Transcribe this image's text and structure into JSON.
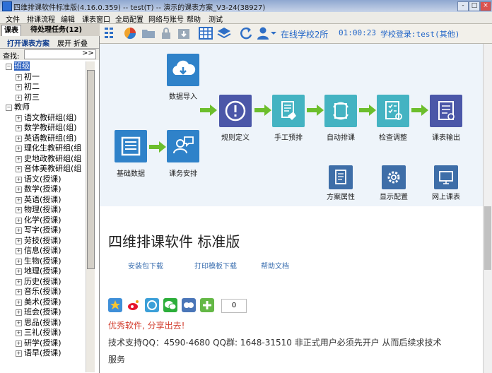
{
  "window": {
    "title": "四维排课软件标准版(4.16.0.359) -- test(T) -- 演示的课表方案_V3-24(38927)",
    "minimize": "-",
    "maximize": "□",
    "close": "×"
  },
  "menu": [
    "文件",
    "排课流程",
    "编辑",
    "课表窗口",
    "全局配置",
    "网络与账号",
    "帮助",
    "测试"
  ],
  "left_tabs": [
    "课表",
    "待处理任务(12)"
  ],
  "left_actions": {
    "open": "打开课表方案",
    "expand": "展开",
    "collapse": "折叠",
    "more": ">>"
  },
  "search_label": "查找:",
  "tree": [
    {
      "label": "班级",
      "expanded": true,
      "selected": true,
      "children": [
        "初一",
        "初二",
        "初三"
      ]
    },
    {
      "label": "教师",
      "expanded": true,
      "children": [
        "语文教研组(组)",
        "数学教研组(组)",
        "英语教研组(组)",
        "理化生教研组(组",
        "史地政教研组(组",
        "音体美教研组(组",
        "语文(授课)",
        "数学(授课)",
        "英语(授课)",
        "物理(授课)",
        "化学(授课)",
        "写字(授课)",
        "劳技(授课)",
        "信息(授课)",
        "生物(授课)",
        "地理(授课)",
        "历史(授课)",
        "音乐(授课)",
        "美术(授课)",
        "班会(授课)",
        "思品(授课)",
        "三礼(授课)",
        "研学(授课)",
        "语早(授课)"
      ]
    }
  ],
  "toolbar": {
    "icons": [
      "grid-icon",
      "pie-chart-icon",
      "open-folder-icon",
      "lock-icon",
      "download-icon",
      "table-icon",
      "layers-icon",
      "refresh-icon",
      "user-icon"
    ],
    "school": "在线学校2所",
    "timer": "01:00:23",
    "login": "学校登录:test(其他)"
  },
  "flow": {
    "import": "数据导入",
    "basic": "基础数据",
    "course": "课务安排",
    "rules": "规则定义",
    "manual": "手工预排",
    "auto": "自动排课",
    "check": "检查调整",
    "output": "课表输出",
    "plan_props": "方案属性",
    "display_config": "显示配置",
    "online": "网上课表"
  },
  "colors": {
    "blue": "#2f82c9",
    "teal": "#44b3c2",
    "purple": "#4b57a8",
    "green": "#6cbe2c",
    "dark_blue": "#3e6ea8"
  },
  "product": {
    "heading": "四维排课软件 标准版",
    "links": [
      "安装包下载",
      "打印模板下载",
      "帮助文档"
    ],
    "share_count": "0",
    "promo": "优秀软件, 分享出去!",
    "support": "技术支持QQ：4590-4680 QQ群: 1648-31510 非正式用户必须先开户 从而后续求技术",
    "support2": "服务"
  }
}
